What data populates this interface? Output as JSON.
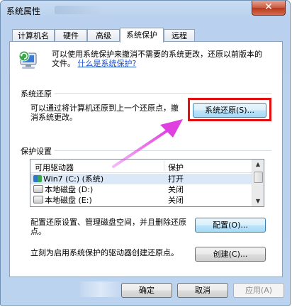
{
  "window": {
    "title": "系统属性",
    "close_glyph": "✕"
  },
  "tabs": [
    {
      "label": "计算机名"
    },
    {
      "label": "硬件"
    },
    {
      "label": "高级"
    },
    {
      "label": "系统保护"
    },
    {
      "label": "远程"
    }
  ],
  "intro": {
    "text": "可以使用系统保护来撤消不需要的系统更改，还原以前版本的文件。",
    "link": "什么是系统保护?"
  },
  "restore": {
    "group_label": "系统还原",
    "description": "可以通过将计算机还原到上一个还原点，撤消系统更改。",
    "button": "系统还原(S)..."
  },
  "protection": {
    "group_label": "保护设置",
    "columns": [
      "可用驱动器",
      "保护"
    ],
    "rows": [
      {
        "drive": "Win7 (C:) (系统)",
        "status": "打开"
      },
      {
        "drive": "本地磁盘 (D:)",
        "status": "关闭"
      },
      {
        "drive": "本地磁盘 (E:)",
        "status": "关闭"
      }
    ],
    "configure_text": "配置还原设置、管理磁盘空间，并且删除还原点。",
    "configure_button": "配置(O)...",
    "create_text": "立刻为启用系统保护的驱动器创建还原点。",
    "create_button": "创建(C)..."
  },
  "footer": {
    "ok": "确定",
    "cancel": "取消",
    "apply": "应用(A)"
  },
  "colors": {
    "highlight": "#e01010",
    "arrow": "#e040e0",
    "link": "#1a4fc9"
  },
  "icons": {
    "system": "computer-restore-icon",
    "scroll_up": "▲",
    "scroll_down": "▼"
  }
}
